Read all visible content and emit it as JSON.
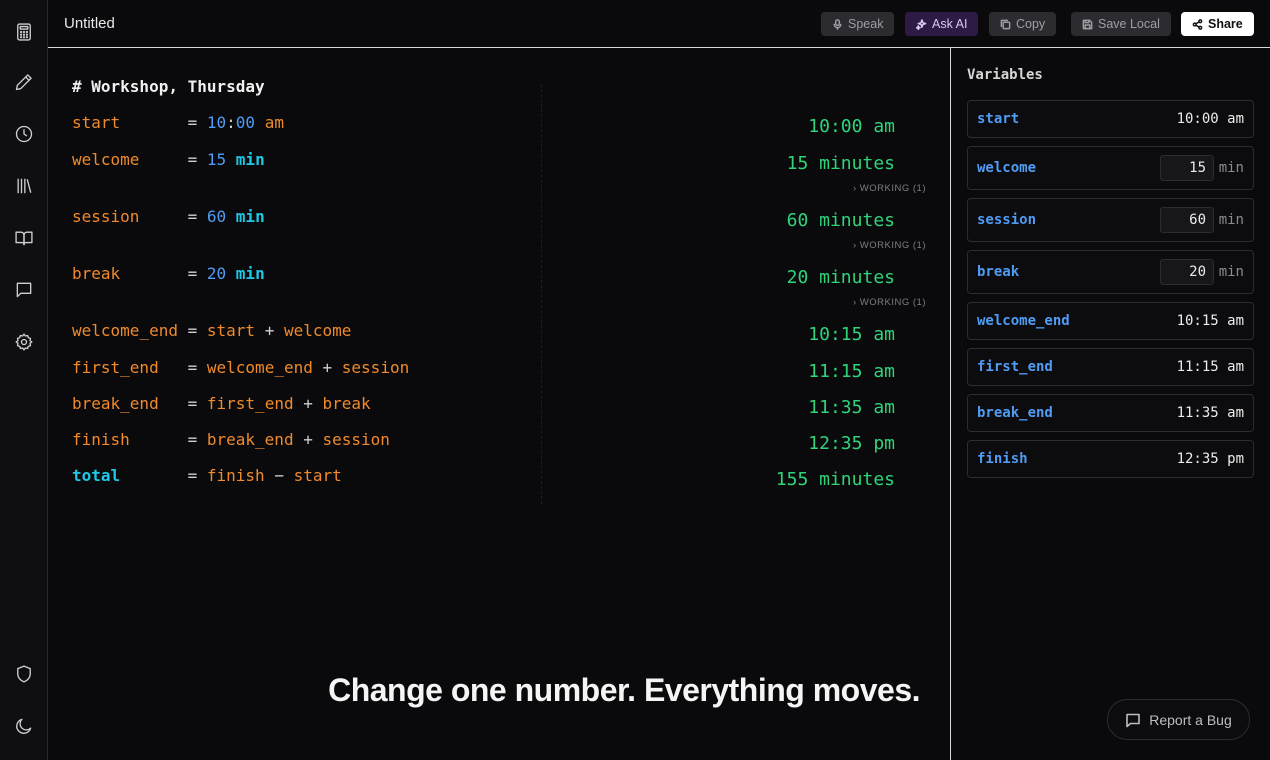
{
  "topbar": {
    "title": "Untitled",
    "speak_label": "Speak",
    "ask_ai_label": "Ask AI",
    "copy_label": "Copy",
    "save_local_label": "Save Local",
    "share_label": "Share"
  },
  "editor": {
    "heading": "# Workshop, Thursday",
    "working_label": "WORKING (1)",
    "lines": {
      "start": {
        "name": "start",
        "eq": "=",
        "hour": "10",
        "colon": ":",
        "minute": "00",
        "period": "am",
        "result": "10:00 am"
      },
      "welcome": {
        "name": "welcome",
        "eq": "=",
        "num": "15",
        "unit": "min",
        "result": "15 minutes"
      },
      "session": {
        "name": "session",
        "eq": "=",
        "num": "60",
        "unit": "min",
        "result": "60 minutes"
      },
      "break": {
        "name": "break",
        "eq": "=",
        "num": "20",
        "unit": "min",
        "result": "20 minutes"
      },
      "welcome_end": {
        "name": "welcome_end",
        "eq": "=",
        "a": "start",
        "op": "+",
        "b": "welcome",
        "result": "10:15 am"
      },
      "first_end": {
        "name": "first_end",
        "eq": "=",
        "a": "welcome_end",
        "op": "+",
        "b": "session",
        "result": "11:15 am"
      },
      "break_end": {
        "name": "break_end",
        "eq": "=",
        "a": "first_end",
        "op": "+",
        "b": "break",
        "result": "11:35 am"
      },
      "finish": {
        "name": "finish",
        "eq": "=",
        "a": "break_end",
        "op": "+",
        "b": "session",
        "result": "12:35 pm"
      },
      "total": {
        "name": "total",
        "eq": "=",
        "a": "finish",
        "op": "−",
        "b": "start",
        "result": "155 minutes"
      }
    },
    "tagline": "Change one number. Everything moves."
  },
  "variables": {
    "title": "Variables",
    "items": [
      {
        "name": "start",
        "value": "10:00 am"
      },
      {
        "name": "welcome",
        "value": "15",
        "unit": "min"
      },
      {
        "name": "session",
        "value": "60",
        "unit": "min"
      },
      {
        "name": "break",
        "value": "20",
        "unit": "min"
      },
      {
        "name": "welcome_end",
        "value": "10:15 am"
      },
      {
        "name": "first_end",
        "value": "11:15 am"
      },
      {
        "name": "break_end",
        "value": "11:35 am"
      },
      {
        "name": "finish",
        "value": "12:35 pm"
      }
    ]
  },
  "report_bug_label": "Report a Bug",
  "colors": {
    "variable": "#f08a2c",
    "number": "#4f9cf5",
    "unit": "#1ec8e6",
    "result": "#2fd47a",
    "ask_ai_bg": "#2d1a45"
  },
  "icons": {
    "sidebar": [
      "calculator-icon",
      "pencil-icon",
      "clock-icon",
      "library-icon",
      "book-icon",
      "chat-icon",
      "gear-icon",
      "shield-icon",
      "moon-icon"
    ],
    "speak": "microphone-icon",
    "ask_ai": "sparkle-icon",
    "copy": "copy-icon",
    "save_local": "save-icon",
    "share": "share-icon",
    "report_bug": "message-icon"
  }
}
